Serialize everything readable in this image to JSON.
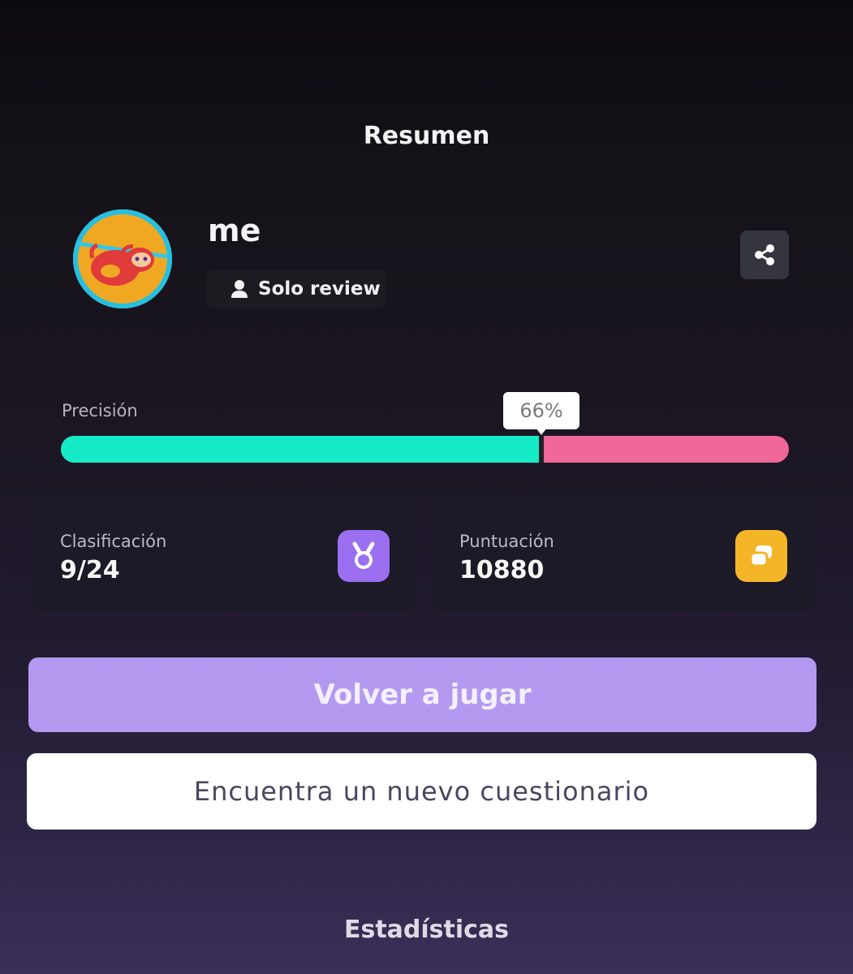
{
  "header": {
    "title": "Resumen"
  },
  "player": {
    "name": "me",
    "mode_label": "Solo review",
    "avatar_icon": "sloth-avatar",
    "mode_icon": "user-icon"
  },
  "share": {
    "icon": "share-icon"
  },
  "accuracy": {
    "label": "Precisión",
    "value_text": "66%",
    "value": 0.66,
    "correct_color": "#16ebc7",
    "incorrect_color": "#f0679a"
  },
  "stats": {
    "rank": {
      "label": "Clasificación",
      "value": "9/24",
      "icon": "medal-icon",
      "color": "#9b6ff0"
    },
    "score": {
      "label": "Puntuación",
      "value": "10880",
      "icon": "score-icon",
      "color": "#f5b528"
    }
  },
  "actions": {
    "play_again": "Volver a jugar",
    "find_new": "Encuentra un nuevo cuestionario"
  },
  "footer": {
    "title": "Estadísticas"
  }
}
